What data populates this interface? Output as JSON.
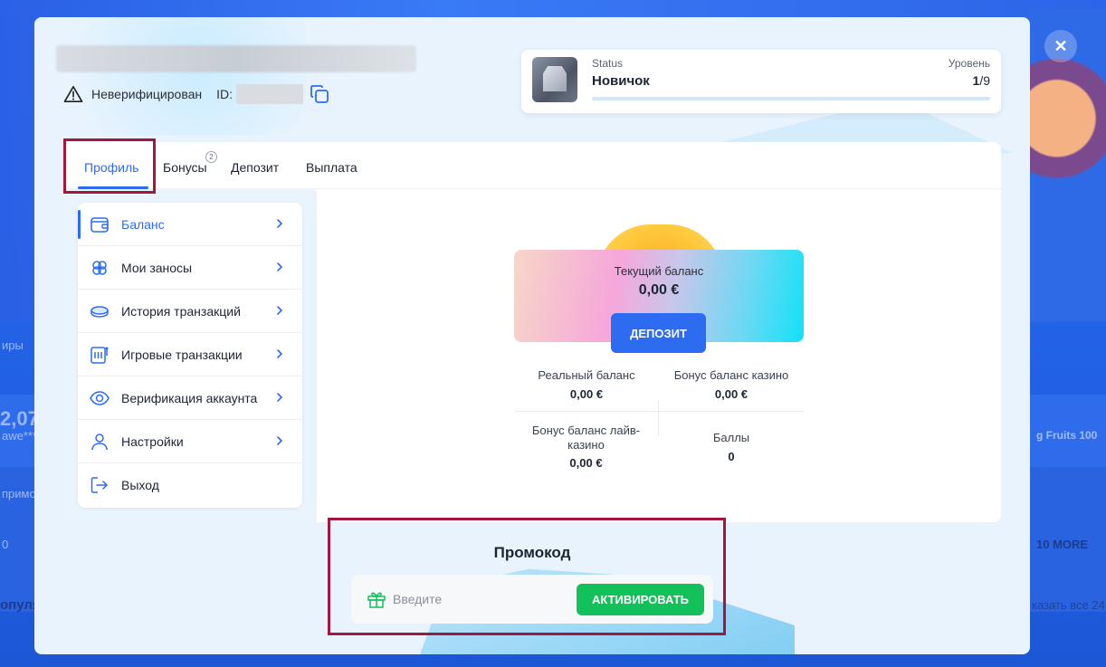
{
  "background": {
    "left_fragments": [
      "иры",
      "2,07",
      "awe***",
      "примо",
      "0",
      "опуля"
    ],
    "right_fragments": [
      "g Fruits 100",
      "10 MORE",
      "казать все 24"
    ]
  },
  "header": {
    "verification_status": "Неверифицирован",
    "id_label": "ID:"
  },
  "status_card": {
    "status_label": "Status",
    "status_value": "Новичок",
    "level_label": "Уровень",
    "level_current": "1",
    "level_total": "/9",
    "level_progress": 0
  },
  "tabs": [
    {
      "label": "Профиль",
      "active": true
    },
    {
      "label": "Бонусы",
      "badge": "2"
    },
    {
      "label": "Депозит"
    },
    {
      "label": "Выплата"
    }
  ],
  "sidebar": {
    "items": [
      {
        "label": "Баланс",
        "icon": "wallet-icon",
        "active": true
      },
      {
        "label": "Мои заносы",
        "icon": "clover-icon"
      },
      {
        "label": "История транзакций",
        "icon": "coin-stack-icon"
      },
      {
        "label": "Игровые транзакции",
        "icon": "slot-machine-icon"
      },
      {
        "label": "Верификация аккаунта",
        "icon": "eye-icon"
      },
      {
        "label": "Настройки",
        "icon": "user-icon"
      },
      {
        "label": "Выход",
        "icon": "logout-icon"
      }
    ]
  },
  "balance": {
    "current_label": "Текущий баланс",
    "current_value": "0,00 €",
    "deposit_button": "ДЕПОЗИТ",
    "real_label": "Реальный баланс",
    "real_value": "0,00 €",
    "casino_bonus_label": "Бонус баланс казино",
    "casino_bonus_value": "0,00 €",
    "live_bonus_label": "Бонус баланс лайв-казино",
    "live_bonus_value": "0,00 €",
    "points_label": "Баллы",
    "points_value": "0"
  },
  "promo": {
    "title": "Промокод",
    "placeholder": "Введите",
    "activate_button": "АКТИВИРОВАТЬ"
  },
  "colors": {
    "accent": "#2d6cf1",
    "activate": "#12c15a",
    "highlight_box": "#a3163d",
    "background": "#1f5fe0"
  }
}
